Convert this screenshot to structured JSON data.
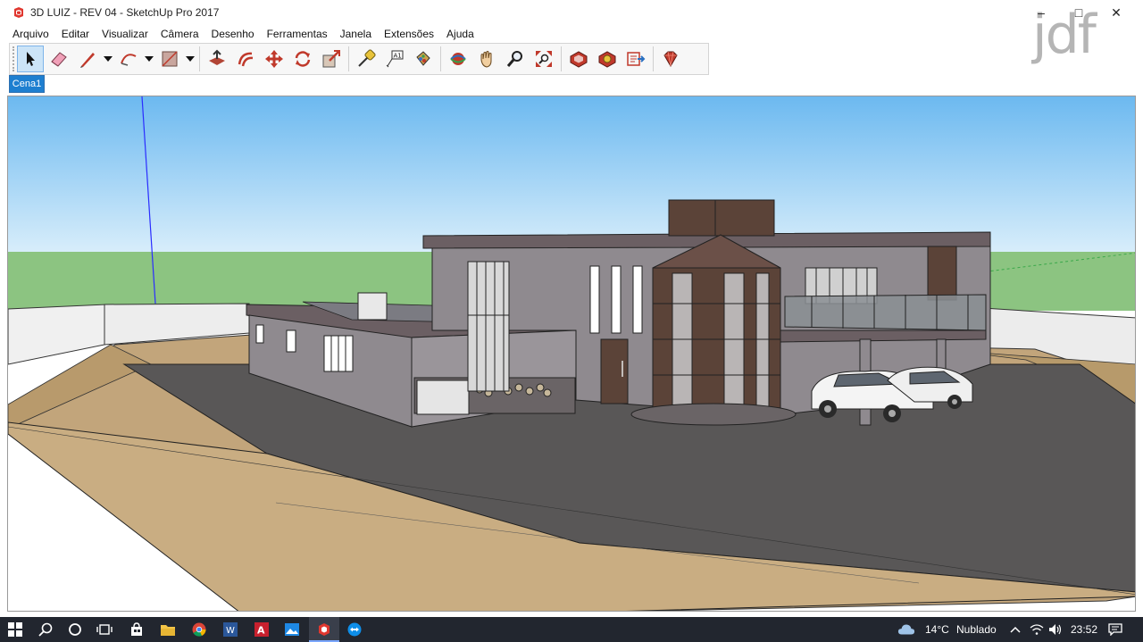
{
  "window": {
    "title": "3D LUIZ - REV 04 - SketchUp Pro 2017",
    "watermark": "jdf",
    "controls": {
      "minimize": "–",
      "maximize": "□",
      "close": "✕"
    }
  },
  "menu": {
    "items": [
      "Arquivo",
      "Editar",
      "Visualizar",
      "Câmera",
      "Desenho",
      "Ferramentas",
      "Janela",
      "Extensões",
      "Ajuda"
    ]
  },
  "toolbar": {
    "tools": [
      "select-icon",
      "eraser-icon",
      "line-icon",
      "arc-icon",
      "rectangle-icon",
      "push-pull-icon",
      "offset-icon",
      "move-icon",
      "rotate-icon",
      "scale-icon",
      "tape-measure-icon",
      "text-icon",
      "paint-bucket-icon",
      "orbit-icon",
      "pan-icon",
      "zoom-icon",
      "zoom-extents-icon",
      "warehouse-icon",
      "extension-warehouse-icon",
      "send-to-layout-icon",
      "ruby-console-icon"
    ],
    "active_tool": "select-icon"
  },
  "scenes": {
    "tabs": [
      "Cena1"
    ]
  },
  "taskbar": {
    "weather_temp": "14°C",
    "weather_text": "Nublado",
    "time": "23:52",
    "apps": [
      "windows-start-icon",
      "search-icon",
      "cortana-icon",
      "task-view-icon",
      "store-icon",
      "file-explorer-icon",
      "chrome-icon",
      "word-icon",
      "autocad-icon",
      "photos-icon",
      "sketchup-icon",
      "teamviewer-icon"
    ]
  },
  "colors": {
    "accent": "#1e7fd0",
    "taskbar": "#22262f",
    "sky_top": "#6cb9f0",
    "grass": "#8cc481",
    "ground_tan": "#c2a57b",
    "asphalt": "#595757",
    "building_wall": "#8f8a8f"
  }
}
